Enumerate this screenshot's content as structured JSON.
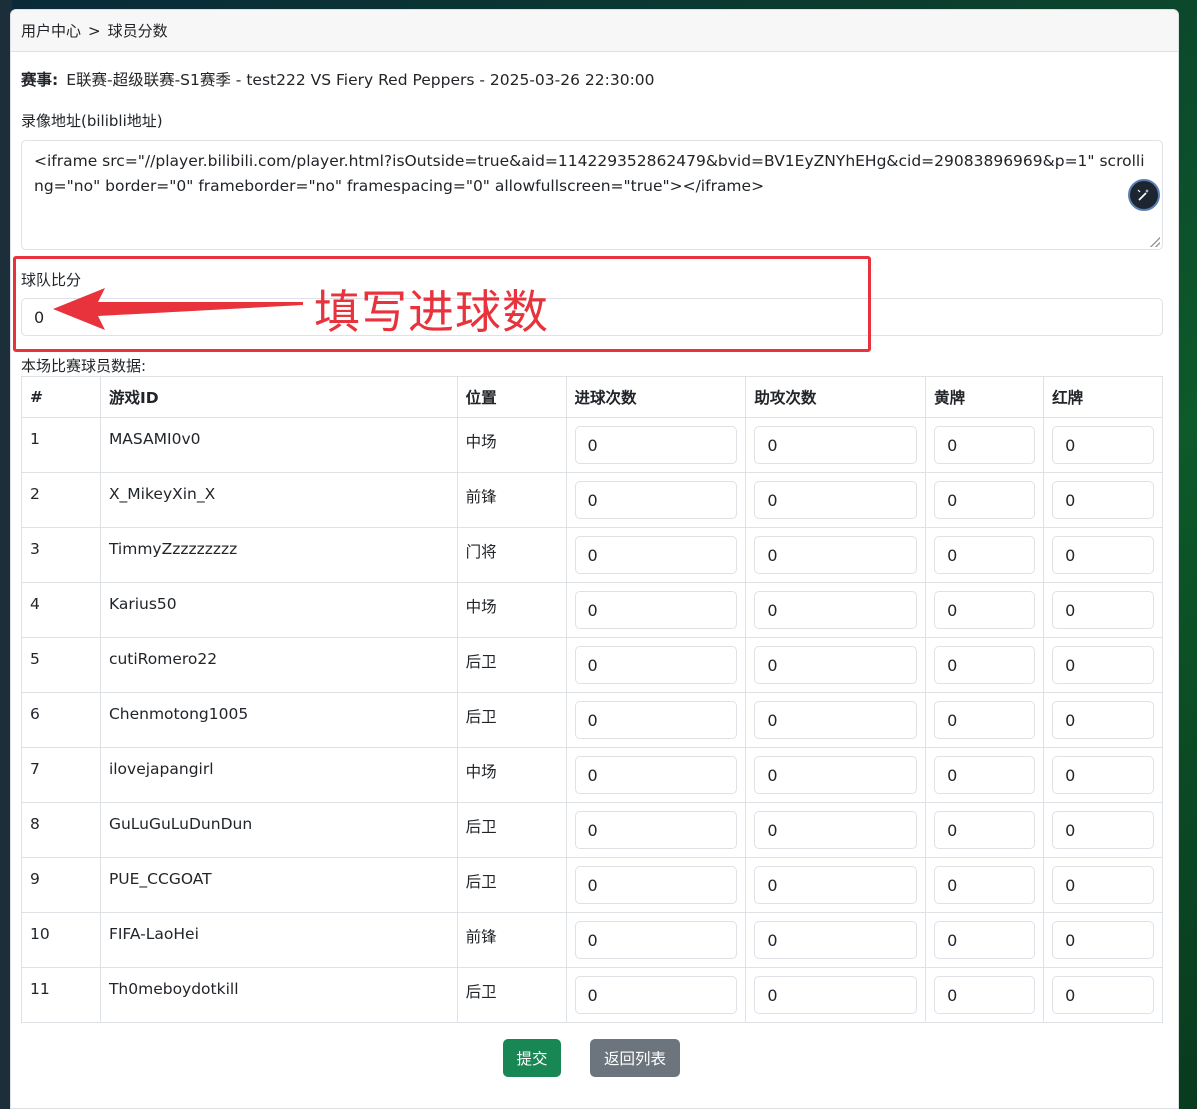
{
  "breadcrumb": {
    "home": "用户中心",
    "separator": ">",
    "current": "球员分数"
  },
  "match": {
    "label": "赛事:",
    "value": "E联赛-超级联赛-S1赛季 - test222 VS Fiery Red Peppers - 2025-03-26 22:30:00"
  },
  "video": {
    "label": "录像地址(bilibli地址)",
    "value": "<iframe src=\"//player.bilibili.com/player.html?isOutside=true&aid=114229352862479&bvid=BV1EyZNYhEHg&cid=29083896969&p=1\" scrolling=\"no\" border=\"0\" frameborder=\"no\" framespacing=\"0\" allowfullscreen=\"true\"></iframe>"
  },
  "score": {
    "label": "球队比分",
    "value": "0"
  },
  "annotation": {
    "text": "填写进球数",
    "color": "#e8323c"
  },
  "players_section_label": "本场比赛球员数据:",
  "table": {
    "headers": [
      "#",
      "游戏ID",
      "位置",
      "进球次数",
      "助攻次数",
      "黄牌",
      "红牌"
    ],
    "rows": [
      {
        "no": "1",
        "id": "MASAMI0v0",
        "pos": "中场",
        "goals": "0",
        "assists": "0",
        "yellow": "0",
        "red": "0"
      },
      {
        "no": "2",
        "id": "X_MikeyXin_X",
        "pos": "前锋",
        "goals": "0",
        "assists": "0",
        "yellow": "0",
        "red": "0"
      },
      {
        "no": "3",
        "id": "TimmyZzzzzzzzz",
        "pos": "门将",
        "goals": "0",
        "assists": "0",
        "yellow": "0",
        "red": "0"
      },
      {
        "no": "4",
        "id": "Karius50",
        "pos": "中场",
        "goals": "0",
        "assists": "0",
        "yellow": "0",
        "red": "0"
      },
      {
        "no": "5",
        "id": "cutiRomero22",
        "pos": "后卫",
        "goals": "0",
        "assists": "0",
        "yellow": "0",
        "red": "0"
      },
      {
        "no": "6",
        "id": "Chenmotong1005",
        "pos": "后卫",
        "goals": "0",
        "assists": "0",
        "yellow": "0",
        "red": "0"
      },
      {
        "no": "7",
        "id": "ilovejapangirl",
        "pos": "中场",
        "goals": "0",
        "assists": "0",
        "yellow": "0",
        "red": "0"
      },
      {
        "no": "8",
        "id": "GuLuGuLuDunDun",
        "pos": "后卫",
        "goals": "0",
        "assists": "0",
        "yellow": "0",
        "red": "0"
      },
      {
        "no": "9",
        "id": "PUE_CCGOAT",
        "pos": "后卫",
        "goals": "0",
        "assists": "0",
        "yellow": "0",
        "red": "0"
      },
      {
        "no": "10",
        "id": "FIFA-LaoHei",
        "pos": "前锋",
        "goals": "0",
        "assists": "0",
        "yellow": "0",
        "red": "0"
      },
      {
        "no": "11",
        "id": "Th0meboydotkill",
        "pos": "后卫",
        "goals": "0",
        "assists": "0",
        "yellow": "0",
        "red": "0"
      }
    ]
  },
  "buttons": {
    "submit": "提交",
    "back": "返回列表"
  },
  "colors": {
    "submit": "#198754",
    "back": "#6c757d"
  }
}
